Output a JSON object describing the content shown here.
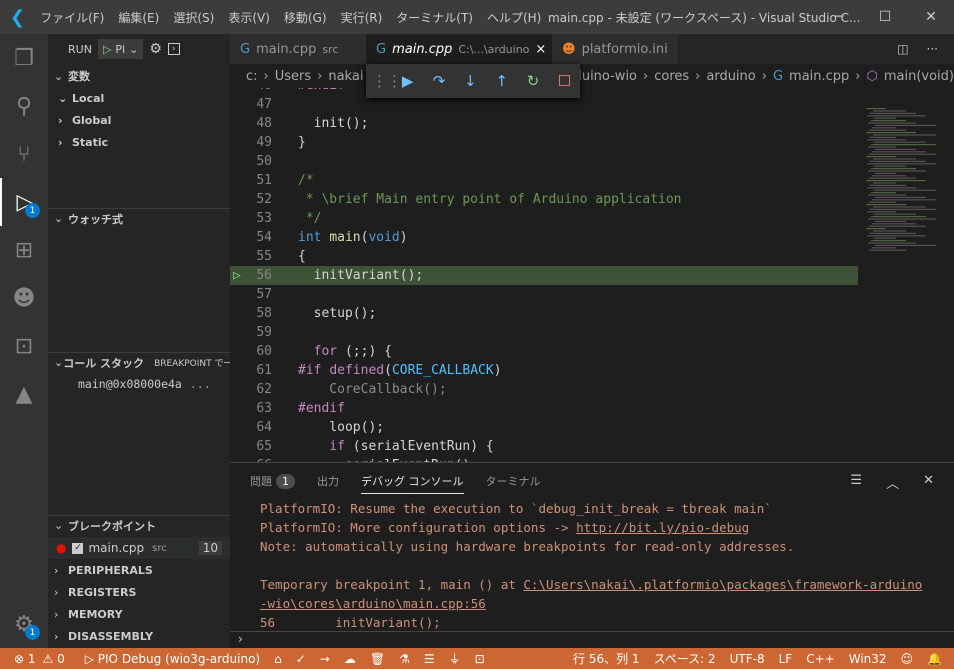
{
  "titlebar": {
    "menus": [
      "ファイル(F)",
      "編集(E)",
      "選択(S)",
      "表示(V)",
      "移動(G)",
      "実行(R)",
      "ターミナル(T)",
      "ヘルプ(H)"
    ],
    "title": "main.cpp - 未設定 (ワークスペース) - Visual Studio C..."
  },
  "activity": {
    "debug_badge": "1",
    "settings_badge": "1"
  },
  "sidebar": {
    "run_label": "RUN",
    "config": "Pl",
    "variables": "変数",
    "scopes": [
      "Local",
      "Global",
      "Static"
    ],
    "watch": "ウォッチ式",
    "callstack": "コール スタック",
    "callstack_state": "BREAKPOINT で一時停止",
    "frame": "main@0x08000e4a",
    "frame_more": "...",
    "breakpoints": "ブレークポイント",
    "bp_file": "main.cpp",
    "bp_dir": "src",
    "bp_line": "10",
    "sections": [
      "PERIPHERALS",
      "REGISTERS",
      "MEMORY",
      "DISASSEMBLY"
    ]
  },
  "tabs": [
    {
      "label": "main.cpp",
      "desc": "src"
    },
    {
      "label": "main.cpp",
      "desc": "C:\\...\\arduino",
      "close": "×"
    },
    {
      "label": "platformio.ini"
    }
  ],
  "breadcrumb": [
    "c:",
    "Users",
    "nakai",
    "arduino-wio",
    "cores",
    "arduino",
    "main.cpp",
    "main(void)"
  ],
  "code": [
    {
      "n": "46",
      "t": [
        [
          "#endif",
          "pp"
        ]
      ]
    },
    {
      "n": "47",
      "t": []
    },
    {
      "n": "48",
      "t": [
        [
          "  init();",
          "tx"
        ]
      ]
    },
    {
      "n": "49",
      "t": [
        [
          "}",
          "tx"
        ]
      ]
    },
    {
      "n": "50",
      "t": []
    },
    {
      "n": "51",
      "t": [
        [
          "/*",
          "cm"
        ]
      ]
    },
    {
      "n": "52",
      "t": [
        [
          " * \\brief Main entry point of Arduino application",
          "cm"
        ]
      ]
    },
    {
      "n": "53",
      "t": [
        [
          " */",
          "cm"
        ]
      ]
    },
    {
      "n": "54",
      "t": [
        [
          "int ",
          "kw"
        ],
        [
          "main",
          "fn"
        ],
        [
          "(",
          "tx"
        ],
        [
          "void",
          "kw"
        ],
        [
          ")",
          "tx"
        ]
      ]
    },
    {
      "n": "55",
      "t": [
        [
          "{",
          "tx"
        ]
      ]
    },
    {
      "n": "56",
      "t": [
        [
          "  initVariant();",
          "tx"
        ]
      ],
      "current": true
    },
    {
      "n": "57",
      "t": []
    },
    {
      "n": "58",
      "t": [
        [
          "  setup();",
          "tx"
        ]
      ]
    },
    {
      "n": "59",
      "t": []
    },
    {
      "n": "60",
      "t": [
        [
          "  for ",
          "pp"
        ],
        [
          "(;;) {",
          "tx"
        ]
      ]
    },
    {
      "n": "61",
      "t": [
        [
          "#if ",
          "pp"
        ],
        [
          "defined",
          "pp"
        ],
        [
          "(",
          "tx"
        ],
        [
          "CORE_CALLBACK",
          "mc"
        ],
        [
          ")",
          "tx"
        ]
      ]
    },
    {
      "n": "62",
      "t": [
        [
          "    CoreCallback();",
          "dim"
        ]
      ]
    },
    {
      "n": "63",
      "t": [
        [
          "#endif",
          "pp"
        ]
      ]
    },
    {
      "n": "64",
      "t": [
        [
          "    loop();",
          "tx"
        ]
      ]
    },
    {
      "n": "65",
      "t": [
        [
          "    if ",
          "pp"
        ],
        [
          "(serialEventRun) {",
          "tx"
        ]
      ]
    },
    {
      "n": "66",
      "t": [
        [
          "      serialEventRun();",
          "tx"
        ]
      ]
    }
  ],
  "panel": {
    "tabs": [
      "問題",
      "出力",
      "デバッグ コンソール",
      "ターミナル"
    ],
    "problems_count": "1",
    "lines": [
      "PlatformIO: Resume the execution to `debug_init_break = tbreak main`",
      "PlatformIO: More configuration options -> ",
      "Note: automatically using hardware breakpoints for read-only addresses.",
      "",
      "Temporary breakpoint 1, main () at ",
      "56        initVariant();"
    ],
    "link1": "http://bit.ly/pio-debug",
    "link2a": "C:\\Users\\nakai\\.platformio\\packages\\framework-arduino",
    "link2b": "-wio\\cores\\arduino\\main.cpp:56",
    "prompt": "›"
  },
  "status": {
    "errors": "⊗ 1",
    "warnings": "⚠ 0",
    "debug": "▷ PIO Debug (wio3g-arduino)",
    "position": "行 56、列 1",
    "spaces": "スペース: 2",
    "encoding": "UTF-8",
    "eol": "LF",
    "language": "C++",
    "platform": "Win32"
  },
  "colors": {
    "status": "#cc6633",
    "current_line": "#3d5237",
    "accent": "#007acc"
  }
}
